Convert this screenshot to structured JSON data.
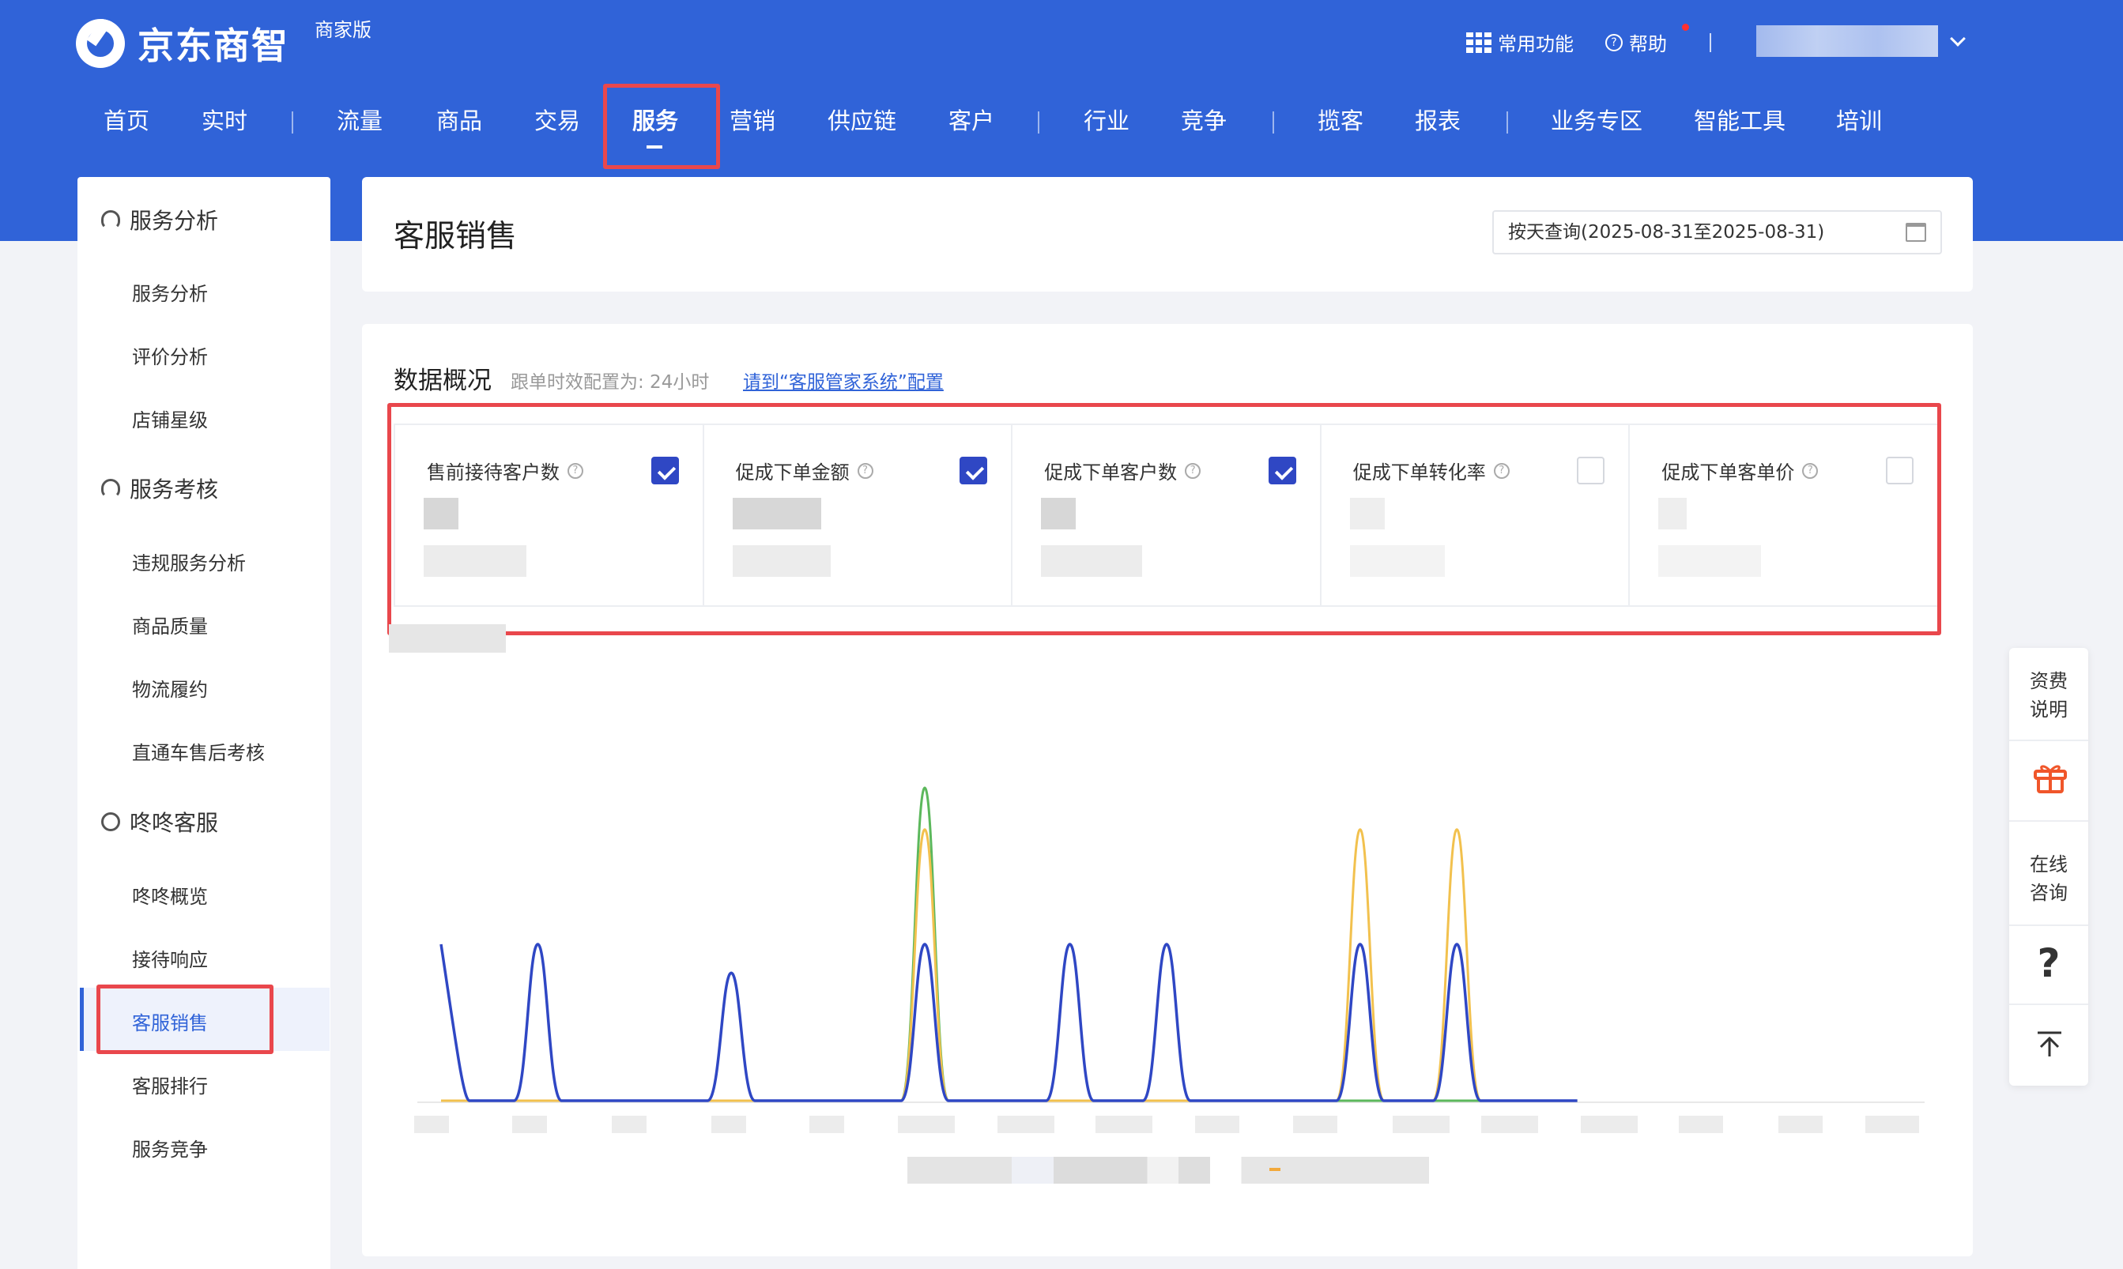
{
  "header": {
    "brand": "京东商智",
    "edition": "商家版",
    "common_functions": "常用功能",
    "help": "帮助"
  },
  "nav": {
    "items": [
      "首页",
      "实时",
      "流量",
      "商品",
      "交易",
      "服务",
      "营销",
      "供应链",
      "客户",
      "行业",
      "竞争",
      "揽客",
      "报表",
      "业务专区",
      "智能工具",
      "培训"
    ],
    "active": "服务"
  },
  "sidebar": {
    "groups": [
      {
        "title": "服务分析",
        "items": [
          "服务分析",
          "评价分析",
          "店铺星级"
        ]
      },
      {
        "title": "服务考核",
        "items": [
          "违规服务分析",
          "商品质量",
          "物流履约",
          "直通车售后考核"
        ]
      },
      {
        "title": "咚咚客服",
        "items": [
          "咚咚概览",
          "接待响应",
          "客服销售",
          "客服排行",
          "服务竞争"
        ]
      }
    ],
    "active_item": "客服销售"
  },
  "page": {
    "title": "客服销售",
    "date_query": "按天查询(2025-08-31至2025-08-31)"
  },
  "overview": {
    "title": "数据概况",
    "subtitle": "跟单时效配置为: 24小时",
    "config_link": "请到“客服管家系统”配置",
    "metrics": [
      {
        "label": "售前接待客户数",
        "checked": true
      },
      {
        "label": "促成下单金额",
        "checked": true
      },
      {
        "label": "促成下单客户数",
        "checked": true
      },
      {
        "label": "促成下单转化率",
        "checked": false
      },
      {
        "label": "促成下单客单价",
        "checked": false
      }
    ]
  },
  "float_tools": {
    "fee": "资费说明",
    "consult": "在线咨询",
    "faq": "?",
    "icons": [
      "gift-icon",
      "back-to-top-icon"
    ]
  },
  "colors": {
    "brand_blue": "#3063d8",
    "series_blue": "#2f47c4",
    "series_yellow": "#f2c14e",
    "series_green": "#5cb85c",
    "highlight_red": "#e9474c"
  },
  "chart_data": {
    "type": "line",
    "categories": [
      "0",
      "1",
      "2",
      "3",
      "4",
      "5",
      "6",
      "7",
      "8",
      "9",
      "10",
      "11",
      "12",
      "13",
      "14",
      "15",
      "16",
      "17",
      "18",
      "19",
      "20",
      "21",
      "22",
      "23"
    ],
    "series": [
      {
        "values": [
          0.6,
          0,
          0.6,
          0,
          0,
          0,
          0.49,
          0,
          0,
          0,
          0.6,
          0,
          0,
          0.6,
          0,
          0.6,
          0,
          0,
          0,
          0.6,
          0,
          0.6,
          0,
          0
        ]
      },
      {
        "values": [
          0,
          0,
          0,
          0,
          0,
          0,
          0,
          0,
          0,
          0,
          1.04,
          0,
          0,
          0,
          0,
          0,
          0,
          0,
          0,
          1.04,
          0,
          1.04,
          0,
          0
        ]
      },
      {
        "values": [
          0,
          0,
          0,
          0,
          0,
          0,
          0,
          0,
          0,
          0,
          1.2,
          0,
          0,
          0,
          0,
          0,
          0,
          0,
          0,
          0,
          0,
          0,
          0,
          0
        ]
      }
    ]
  }
}
